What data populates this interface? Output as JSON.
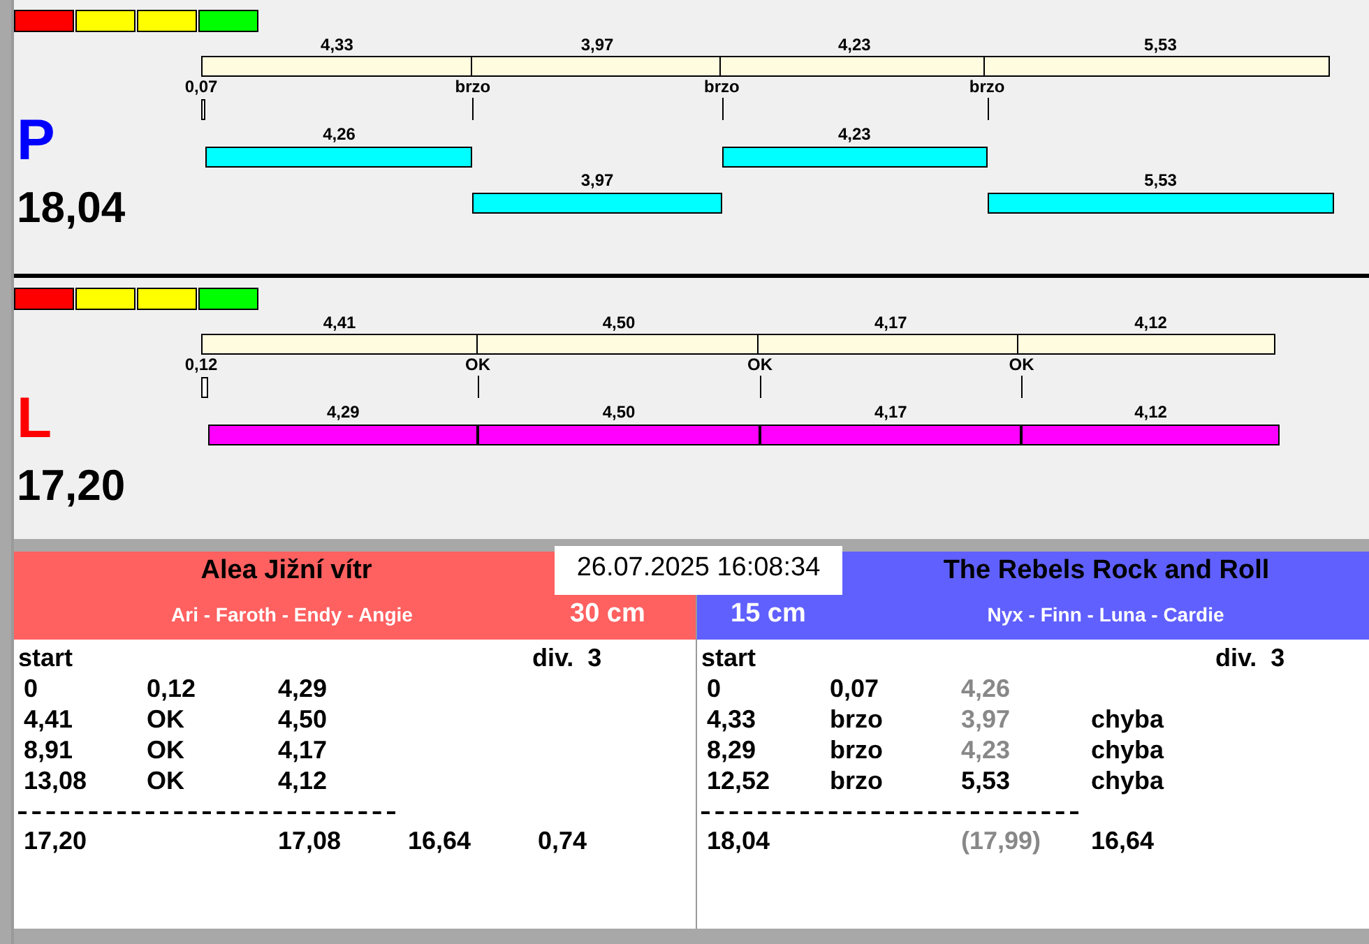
{
  "lanes": [
    {
      "letter": "P",
      "color": "#0000ff",
      "total": "18,04",
      "kind": "alternating",
      "lights": [
        {
          "color": "#ff0000"
        },
        {
          "color": "#ffff00"
        },
        {
          "color": "#ffff00"
        },
        {
          "color": "#00ff00"
        }
      ],
      "laps": [
        "4,33",
        "3,97",
        "4,23",
        "5,53"
      ],
      "splits": [
        "0,07",
        "brzo",
        "brzo",
        "brzo"
      ],
      "runs": [
        {
          "label": "4,26",
          "color": "#00ffff"
        },
        {
          "label": "3,97",
          "color": "#00ffff"
        },
        {
          "label": "4,23",
          "color": "#00ffff"
        },
        {
          "label": "5,53",
          "color": "#00ffff"
        }
      ]
    },
    {
      "letter": "L",
      "color": "#ff0000",
      "total": "17,20",
      "kind": "single",
      "lights": [
        {
          "color": "#ff0000"
        },
        {
          "color": "#ffff00"
        },
        {
          "color": "#ffff00"
        },
        {
          "color": "#00ff00"
        }
      ],
      "laps": [
        "4,41",
        "4,50",
        "4,17",
        "4,12"
      ],
      "splits": [
        "0,12",
        "OK",
        "OK",
        "OK"
      ],
      "runs": [
        {
          "label": "4,29",
          "color": "#ff00ff"
        },
        {
          "label": "4,50",
          "color": "#ff00ff"
        },
        {
          "label": "4,17",
          "color": "#ff00ff"
        },
        {
          "label": "4,12",
          "color": "#ff00ff"
        }
      ]
    }
  ],
  "timestamp": "26.07.2025 16:08:34",
  "teams": [
    {
      "color": "#ff6060",
      "name": "Alea Jižní vítr",
      "members": "Ari - Faroth - Endy - Angie",
      "height": "30 cm",
      "header": {
        "start": "start",
        "division": "div.  3"
      },
      "rows": [
        [
          {
            "kind": "start",
            "text": "0",
            "dimmed": false
          },
          {
            "kind": "split",
            "text": "0,12",
            "dimmed": false
          },
          {
            "kind": "time",
            "text": "4,29",
            "dimmed": false
          }
        ],
        [
          {
            "kind": "start",
            "text": "4,41",
            "dimmed": false
          },
          {
            "kind": "split",
            "text": "OK",
            "dimmed": false
          },
          {
            "kind": "time",
            "text": "4,50",
            "dimmed": false
          }
        ],
        [
          {
            "kind": "start",
            "text": "8,91",
            "dimmed": false
          },
          {
            "kind": "split",
            "text": "OK",
            "dimmed": false
          },
          {
            "kind": "time",
            "text": "4,17",
            "dimmed": false
          }
        ],
        [
          {
            "kind": "start",
            "text": "13,08",
            "dimmed": false
          },
          {
            "kind": "split",
            "text": "OK",
            "dimmed": false
          },
          {
            "kind": "time",
            "text": "4,12",
            "dimmed": false
          }
        ]
      ],
      "summary": [
        {
          "kind": "start",
          "text": "17,20",
          "dimmed": false
        },
        {
          "kind": "time",
          "text": "17,08",
          "dimmed": false
        },
        {
          "kind": "note",
          "text": "16,64",
          "dimmed": false
        },
        {
          "kind": "extra",
          "text": "0,74",
          "dimmed": false
        }
      ]
    },
    {
      "color": "#6060ff",
      "name": "The Rebels Rock and Roll",
      "members": "Nyx - Finn - Luna - Cardie",
      "height": "15 cm",
      "header": {
        "start": "start",
        "division": "div.  3"
      },
      "rows": [
        [
          {
            "kind": "start",
            "text": "0",
            "dimmed": false
          },
          {
            "kind": "split",
            "text": "0,07",
            "dimmed": false
          },
          {
            "kind": "time",
            "text": "4,26",
            "dimmed": true
          }
        ],
        [
          {
            "kind": "start",
            "text": "4,33",
            "dimmed": false
          },
          {
            "kind": "split",
            "text": "brzo",
            "dimmed": false
          },
          {
            "kind": "time",
            "text": "3,97",
            "dimmed": true
          },
          {
            "kind": "note",
            "text": "chyba",
            "dimmed": false
          }
        ],
        [
          {
            "kind": "start",
            "text": "8,29",
            "dimmed": false
          },
          {
            "kind": "split",
            "text": "brzo",
            "dimmed": false
          },
          {
            "kind": "time",
            "text": "4,23",
            "dimmed": true
          },
          {
            "kind": "note",
            "text": "chyba",
            "dimmed": false
          }
        ],
        [
          {
            "kind": "start",
            "text": "12,52",
            "dimmed": false
          },
          {
            "kind": "split",
            "text": "brzo",
            "dimmed": false
          },
          {
            "kind": "time",
            "text": "5,53",
            "dimmed": false
          },
          {
            "kind": "note",
            "text": "chyba",
            "dimmed": false
          }
        ]
      ],
      "summary": [
        {
          "kind": "start",
          "text": "18,04",
          "dimmed": false
        },
        {
          "kind": "time",
          "text": "(17,99)",
          "dimmed": true
        },
        {
          "kind": "note",
          "text": "16,64",
          "dimmed": false
        }
      ]
    }
  ]
}
